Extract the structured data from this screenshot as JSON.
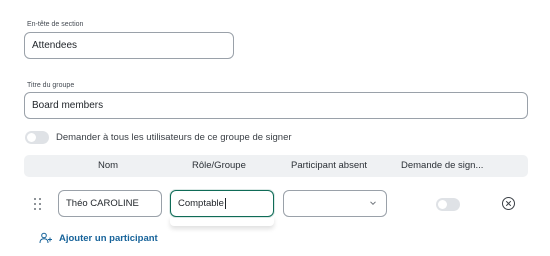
{
  "section_header": {
    "label": "En-tête de section",
    "value": "Attendees"
  },
  "group_title": {
    "label": "Titre du groupe",
    "value": "Board members"
  },
  "sign_all_toggle": {
    "label": "Demander à tous les utilisateurs de ce groupe de signer",
    "on": false
  },
  "table": {
    "columns": [
      "Nom",
      "Rôle/Groupe",
      "Participant absent",
      "Demande de sign..."
    ],
    "rows": [
      {
        "name": "Théo CAROLINE",
        "role": "Comptable",
        "absent": "",
        "signature_request": false
      }
    ]
  },
  "add_participant_label": "Ajouter un participant",
  "colors": {
    "focus_border": "#0f6b57",
    "link": "#17639a",
    "toggle_off": "#dfe2e6",
    "header_bg": "#eff1f3"
  },
  "icons": [
    "drag-handle-icon",
    "chevron-down-icon",
    "close-circle-icon",
    "add-user-icon"
  ]
}
